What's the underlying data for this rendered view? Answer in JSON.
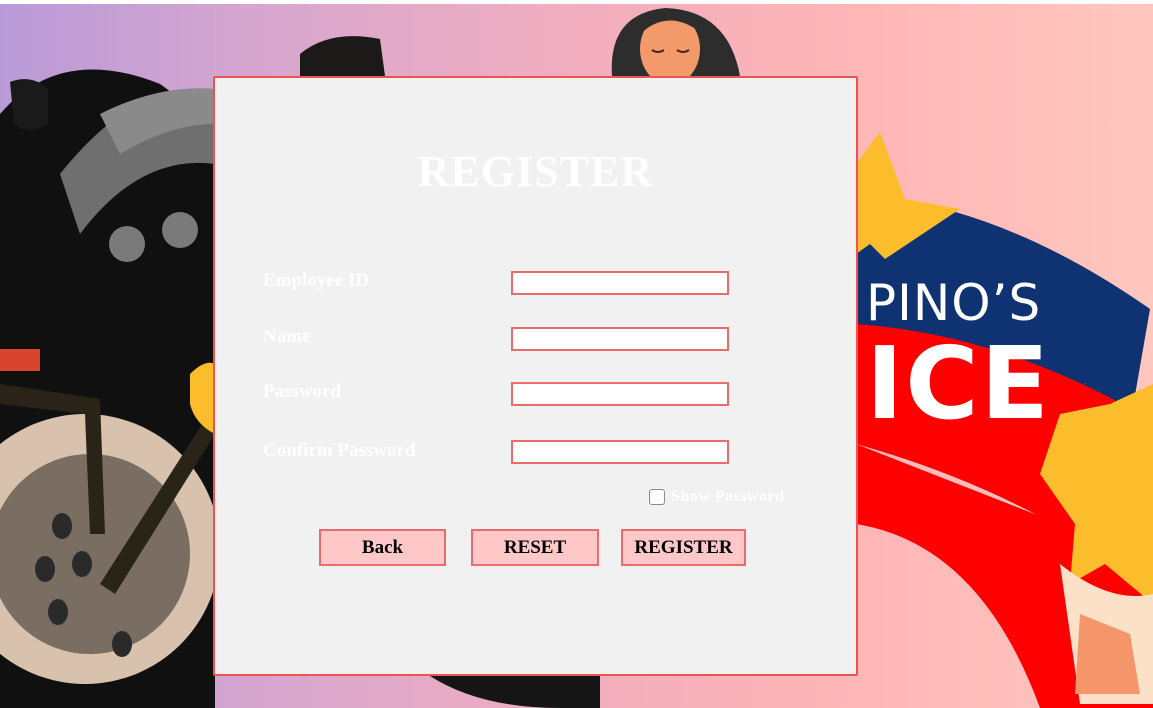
{
  "title": "REGISTER",
  "fields": [
    {
      "label": "Employee ID",
      "value": ""
    },
    {
      "label": "Name",
      "value": ""
    },
    {
      "label": "Password",
      "value": ""
    },
    {
      "label": "Confirm Password",
      "value": ""
    }
  ],
  "show_password": {
    "label": "Show Password",
    "checked": false
  },
  "buttons": {
    "back": "Back",
    "reset": "RESET",
    "register": "REGISTER"
  },
  "banner": {
    "line1": "PINO’S",
    "line2": "ICE"
  },
  "colors": {
    "accent": "#ef5350",
    "button_bg": "#fec8c8",
    "panel_bg": "#f1f1f1",
    "banner_blue": "#0e3272",
    "banner_red": "#ff0000",
    "star_yellow": "#fbbd2c"
  }
}
